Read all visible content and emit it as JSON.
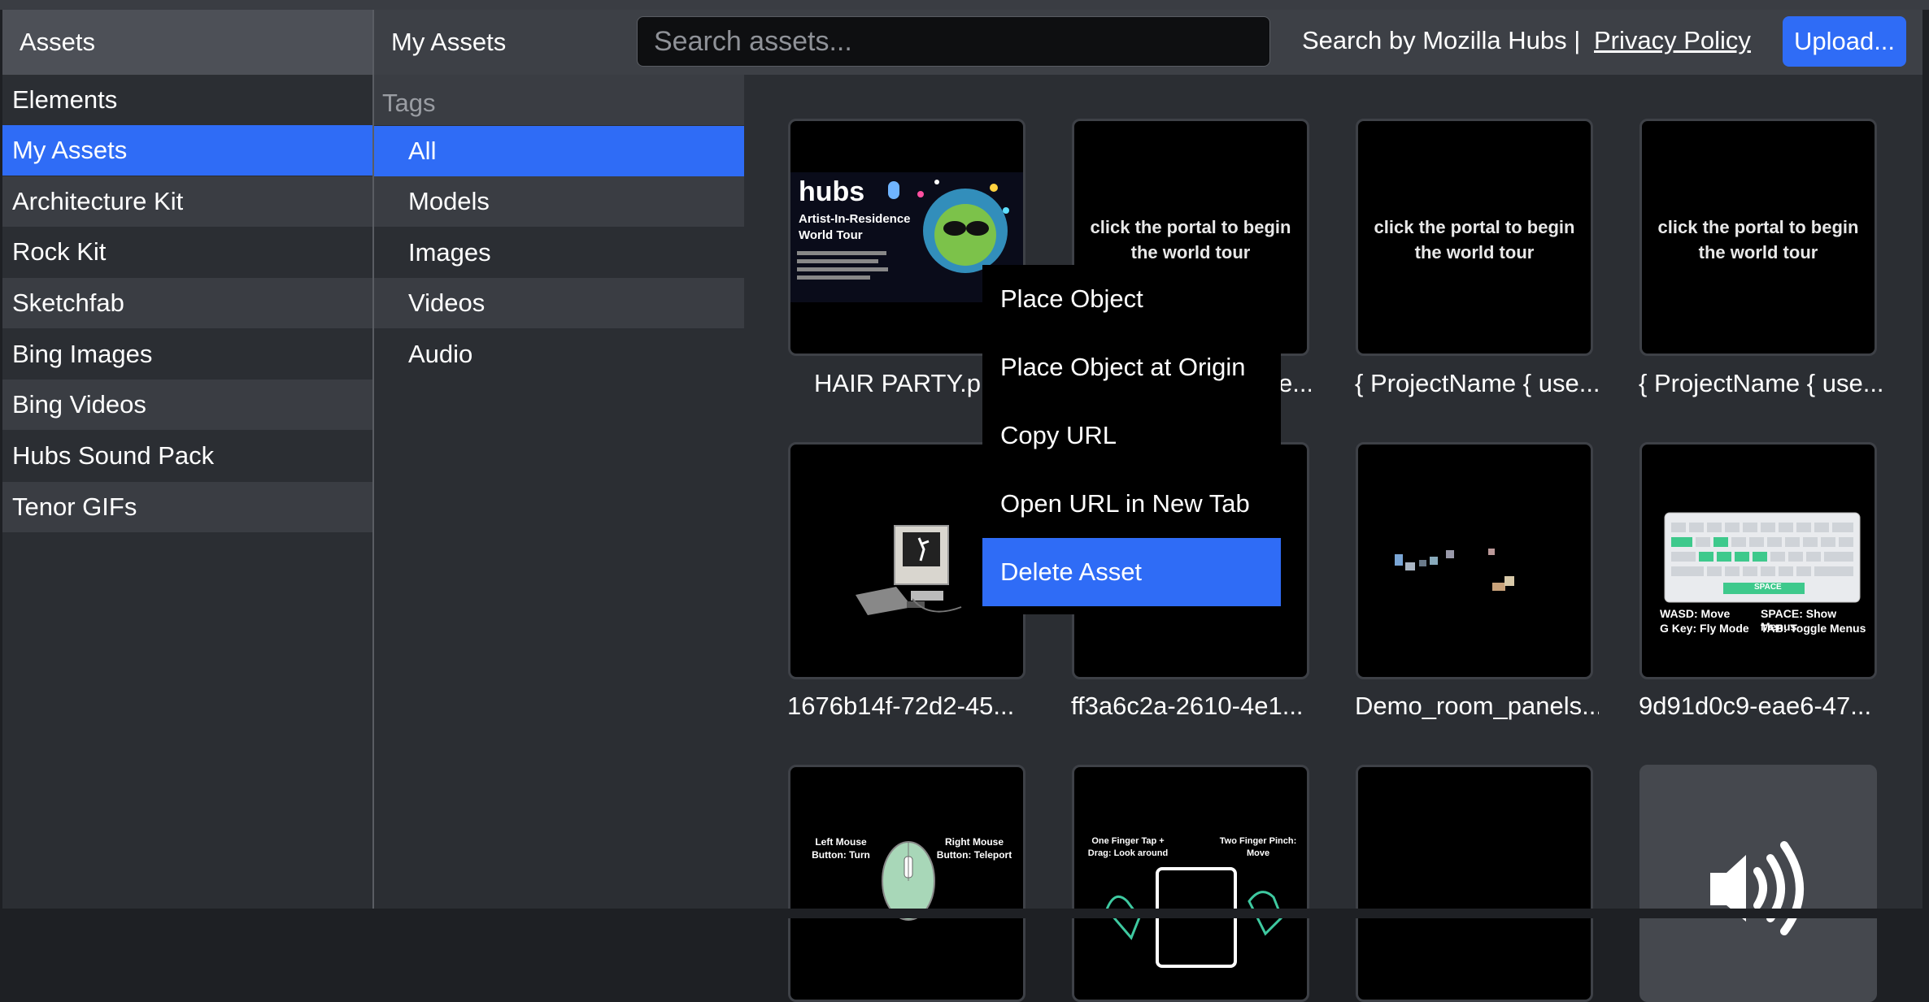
{
  "header": {
    "assets_title": "Assets",
    "section_title": "My Assets",
    "search_placeholder": "Search assets...",
    "search_by": "Search by Mozilla Hubs  |",
    "privacy_link": "Privacy Policy",
    "upload_label": "Upload..."
  },
  "sidebar": {
    "items": [
      {
        "label": "Elements"
      },
      {
        "label": "My Assets"
      },
      {
        "label": "Architecture Kit"
      },
      {
        "label": "Rock Kit"
      },
      {
        "label": "Sketchfab"
      },
      {
        "label": "Bing Images"
      },
      {
        "label": "Bing Videos"
      },
      {
        "label": "Hubs Sound Pack"
      },
      {
        "label": "Tenor GIFs"
      }
    ],
    "selected": "My Assets"
  },
  "tags": {
    "heading": "Tags",
    "items": [
      {
        "label": "All"
      },
      {
        "label": "Models"
      },
      {
        "label": "Images"
      },
      {
        "label": "Videos"
      },
      {
        "label": "Audio"
      }
    ],
    "selected": "All"
  },
  "assets": [
    {
      "label": "HAIR PARTY.pr",
      "thumb": "hubs Artist-In-Residence World Tour"
    },
    {
      "label": "e...",
      "thumb": "click the portal to begin the world tour"
    },
    {
      "label": "{ ProjectName { use...",
      "thumb": "click the portal to begin the world tour"
    },
    {
      "label": "{ ProjectName { use...",
      "thumb": "click the portal to begin the world tour"
    },
    {
      "label": "1676b14f-72d2-45...",
      "thumb": ""
    },
    {
      "label": "ff3a6c2a-2610-4e1...",
      "thumb": ""
    },
    {
      "label": "Demo_room_panels...",
      "thumb": ""
    },
    {
      "label": "9d91d0c9-eae6-47...",
      "thumb": ""
    },
    {
      "label": "",
      "thumb": ""
    },
    {
      "label": "",
      "thumb": ""
    },
    {
      "label": "",
      "thumb": ""
    },
    {
      "label": "",
      "thumb": ""
    }
  ],
  "thumb_text": {
    "hubs_title": "hubs",
    "hubs_sub1": "Artist-In-Residence",
    "hubs_sub2": "World Tour",
    "keyboard_wasd": "WASD: Move",
    "keyboard_space": "SPACE: Show Menus",
    "keyboard_g": "G Key: Fly Mode",
    "keyboard_tab": "TAB: Toggle Menus",
    "keyboard_spacekey": "SPACE",
    "mouse_left": "Left Mouse Button: Turn",
    "mouse_right": "Right Mouse Button: Teleport",
    "touch_one": "One Finger Tap + Drag: Look around",
    "touch_two": "Two Finger Pinch: Move"
  },
  "context_menu": {
    "items": [
      {
        "label": "Place Object"
      },
      {
        "label": "Place Object at Origin"
      },
      {
        "label": "Copy URL"
      },
      {
        "label": "Open URL in New Tab"
      },
      {
        "label": "Delete Asset"
      }
    ],
    "highlighted": "Delete Asset"
  },
  "colors": {
    "accent": "#2f6cf6",
    "panel": "#2b2e33",
    "panel_alt": "#3a3d43"
  }
}
